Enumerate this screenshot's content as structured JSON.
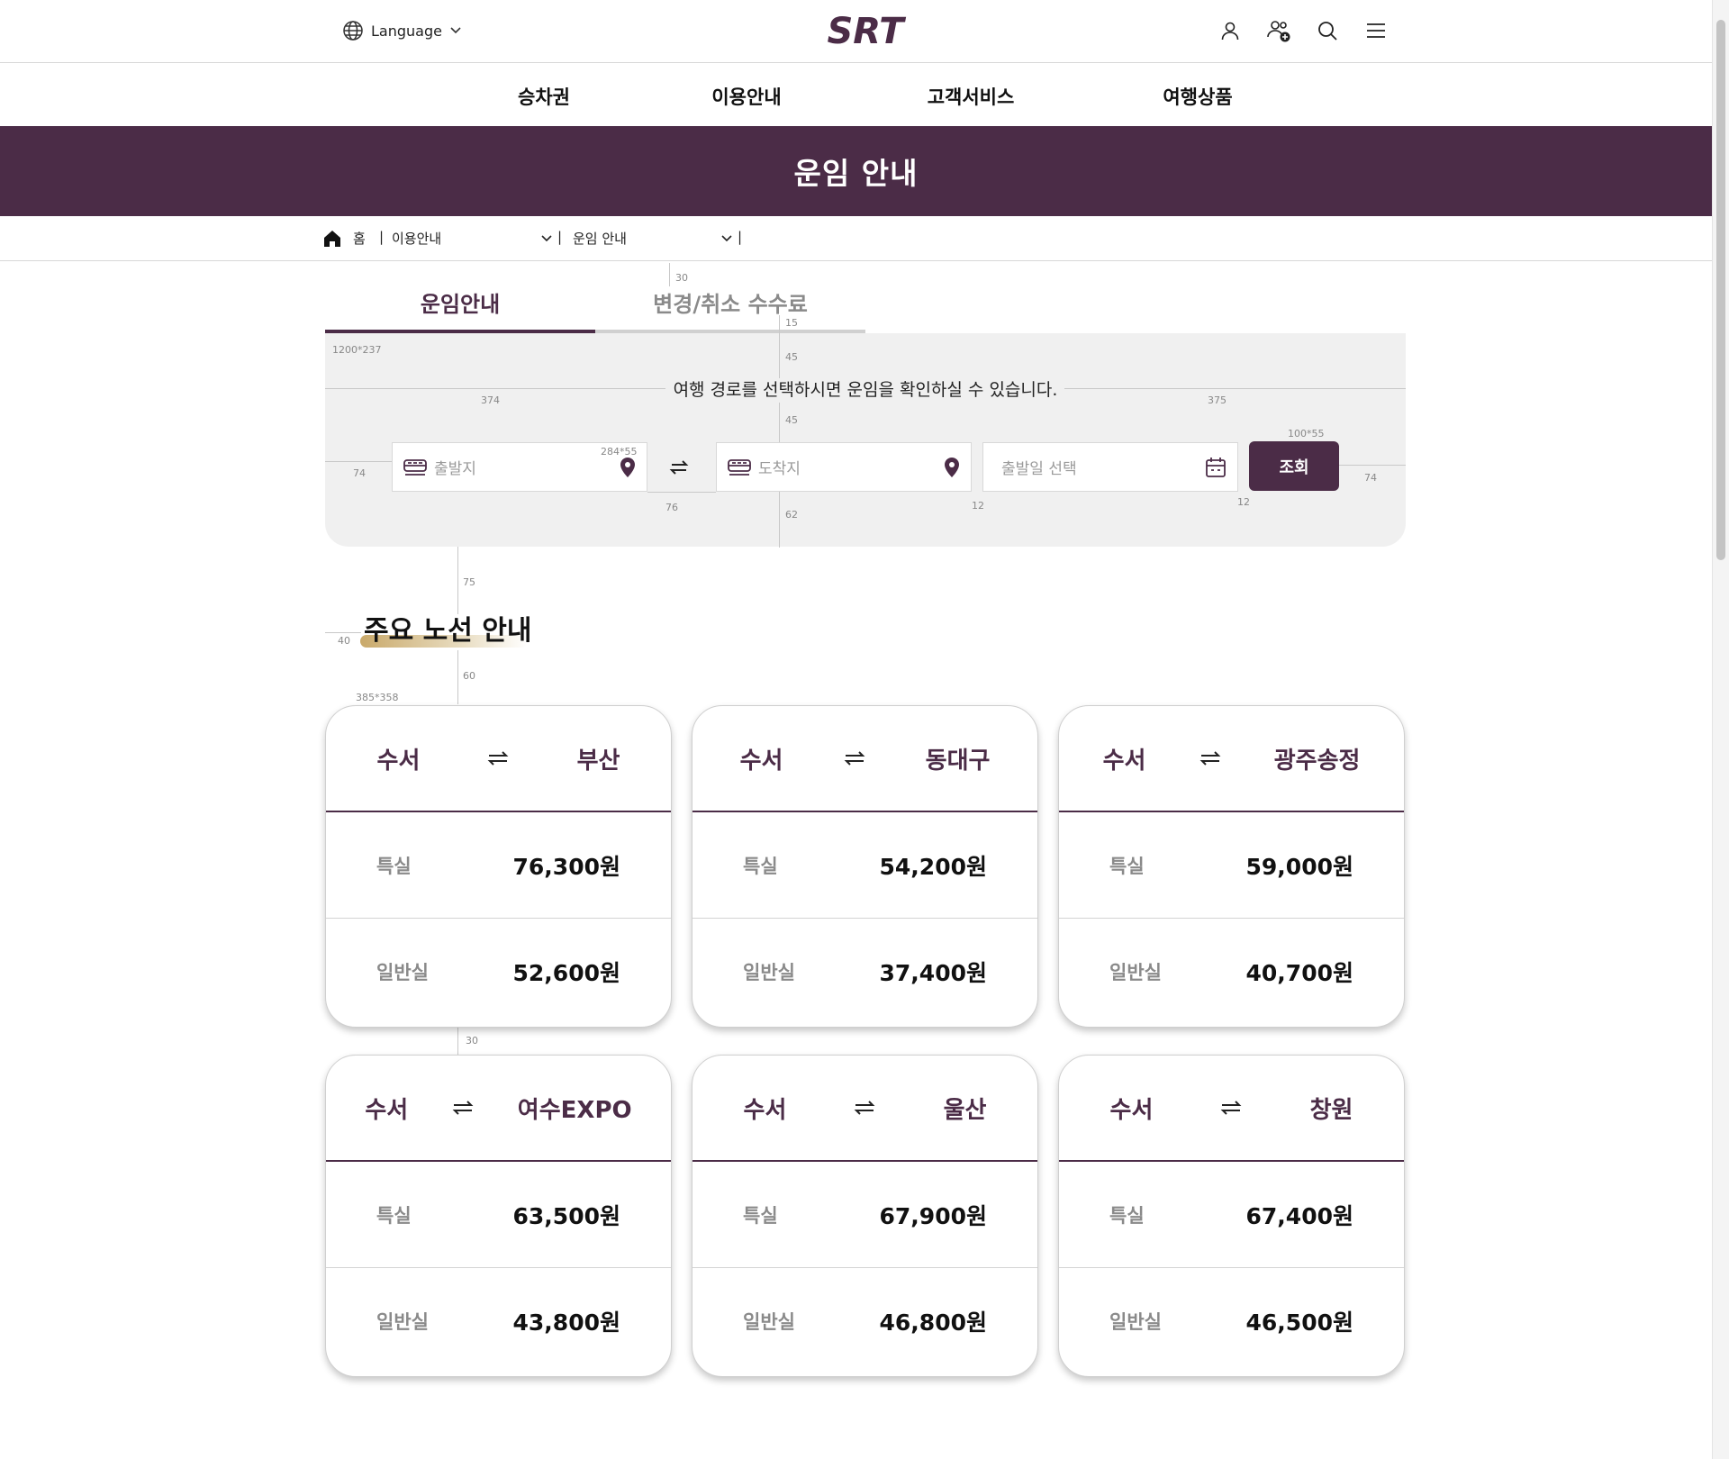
{
  "header": {
    "language_label": "Language",
    "logo_text": "SRT",
    "icons": [
      "user-icon",
      "add-user-icon",
      "search-icon",
      "menu-icon"
    ]
  },
  "gnb": [
    "승차권",
    "이용안내",
    "고객서비스",
    "여행상품"
  ],
  "banner": {
    "title": "운임 안내"
  },
  "breadcrumb": {
    "home": "홈",
    "level1": "이용안내",
    "level2": "운임 안내"
  },
  "tabs": [
    {
      "label": "운임안내",
      "active": true
    },
    {
      "label": "변경/취소 수수료",
      "active": false
    }
  ],
  "search": {
    "guide": "여행 경로를 선택하시면 운임을 확인하실 수 있습니다.",
    "departure_placeholder": "출발지",
    "arrival_placeholder": "도착지",
    "date_placeholder": "출발일 선택",
    "button_label": "조회"
  },
  "annotations": {
    "a30top": "30",
    "a15": "15",
    "a45a": "45",
    "a45b": "45",
    "a1200": "1200*237",
    "a374": "374",
    "a375": "375",
    "a100x55": "100*55",
    "a284": "284*55",
    "a74l": "74",
    "a74r": "74",
    "a76": "76",
    "a62": "62",
    "a12a": "12",
    "a12b": "12",
    "a75": "75",
    "a40": "40",
    "a60": "60",
    "a385": "385*358",
    "a30mid": "30"
  },
  "section": {
    "title": "주요 노선 안내"
  },
  "class_labels": {
    "special": "특실",
    "general": "일반실"
  },
  "routes": [
    {
      "from": "수서",
      "to": "부산",
      "special": "76,300원",
      "general": "52,600원"
    },
    {
      "from": "수서",
      "to": "동대구",
      "special": "54,200원",
      "general": "37,400원"
    },
    {
      "from": "수서",
      "to": "광주송정",
      "special": "59,000원",
      "general": "40,700원"
    },
    {
      "from": "수서",
      "to": "여수EXPO",
      "special": "63,500원",
      "general": "43,800원"
    },
    {
      "from": "수서",
      "to": "울산",
      "special": "67,900원",
      "general": "46,800원"
    },
    {
      "from": "수서",
      "to": "창원",
      "special": "67,400원",
      "general": "46,500원"
    }
  ],
  "colors": {
    "brand": "#4b2c47",
    "panel_bg": "#f0f0f0",
    "highlight": "#c9a96a"
  }
}
